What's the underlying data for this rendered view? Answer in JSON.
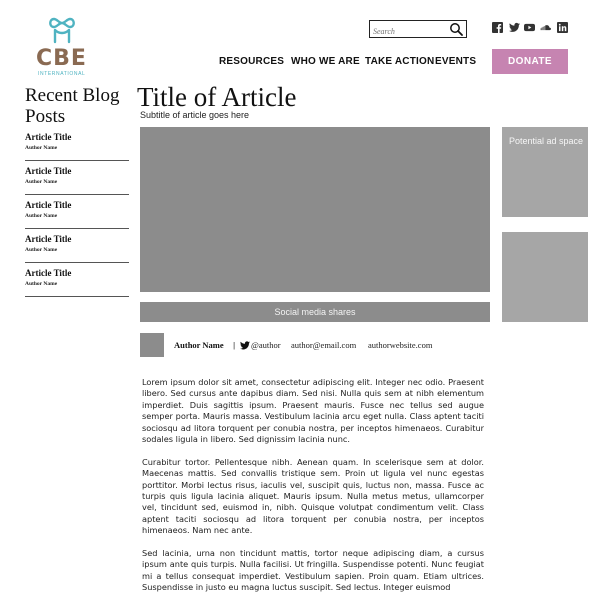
{
  "brand": {
    "logo_text": "CBE",
    "logo_sub": "INTERNATIONAL",
    "teal": "#4fb3c1",
    "brown": "#8a6a52"
  },
  "search": {
    "placeholder": "Search"
  },
  "social_icons": [
    "facebook-icon",
    "twitter-icon",
    "youtube-icon",
    "soundcloud-icon",
    "linkedin-icon"
  ],
  "nav": {
    "items": [
      "RESOURCES",
      "WHO WE ARE",
      "TAKE ACTION",
      "EVENTS"
    ],
    "donate_label": "DONATE",
    "donate_color": "#c684b1"
  },
  "sidebar": {
    "title": "Recent Blog Posts",
    "posts": [
      {
        "title": "Article Title",
        "author": "Author Name"
      },
      {
        "title": "Article Title",
        "author": "Author Name"
      },
      {
        "title": "Article Title",
        "author": "Author Name"
      },
      {
        "title": "Article Title",
        "author": "Author Name"
      },
      {
        "title": "Article Title",
        "author": "Author Name"
      }
    ]
  },
  "article": {
    "title": "Title of Article",
    "subtitle": "Subtitle of article goes here",
    "social_shares": "Social media shares",
    "author": {
      "name": "Author Name",
      "twitter": "@author",
      "email": "author@email.com",
      "website": "authorwebsite.com"
    },
    "paragraphs": [
      "Lorem ipsum dolor sit amet, consectetur adipiscing elit. Integer nec odio. Praesent libero. Sed cursus ante dapibus diam. Sed nisi. Nulla quis sem at nibh elementum imperdiet. Duis sagittis ipsum. Praesent mauris. Fusce nec tellus sed augue semper porta. Mauris massa. Vestibulum lacinia arcu eget nulla. Class aptent taciti sociosqu ad litora torquent per conubia nostra, per inceptos himenaeos. Curabitur sodales ligula in libero. Sed dignissim lacinia nunc.",
      "Curabitur tortor. Pellentesque nibh. Aenean quam. In scelerisque sem at dolor. Maecenas mattis. Sed convallis tristique sem. Proin ut ligula vel nunc egestas porttitor. Morbi lectus risus, iaculis vel, suscipit quis, luctus non, massa. Fusce ac turpis quis ligula lacinia aliquet. Mauris ipsum. Nulla metus metus, ullamcorper vel, tincidunt sed, euismod in, nibh. Quisque volutpat condimentum velit. Class aptent taciti sociosqu ad litora torquent per conubia nostra, per inceptos himenaeos. Nam nec ante.",
      "Sed lacinia, urna non tincidunt mattis, tortor neque adipiscing diam, a cursus ipsum ante quis turpis. Nulla facilisi. Ut fringilla. Suspendisse potenti. Nunc feugiat mi a tellus consequat imperdiet. Vestibulum sapien. Proin quam. Etiam ultrices. Suspendisse in justo eu magna luctus suscipit. Sed lectus. Integer euismod"
    ]
  },
  "ads": {
    "potential_label": "Potential ad space"
  }
}
